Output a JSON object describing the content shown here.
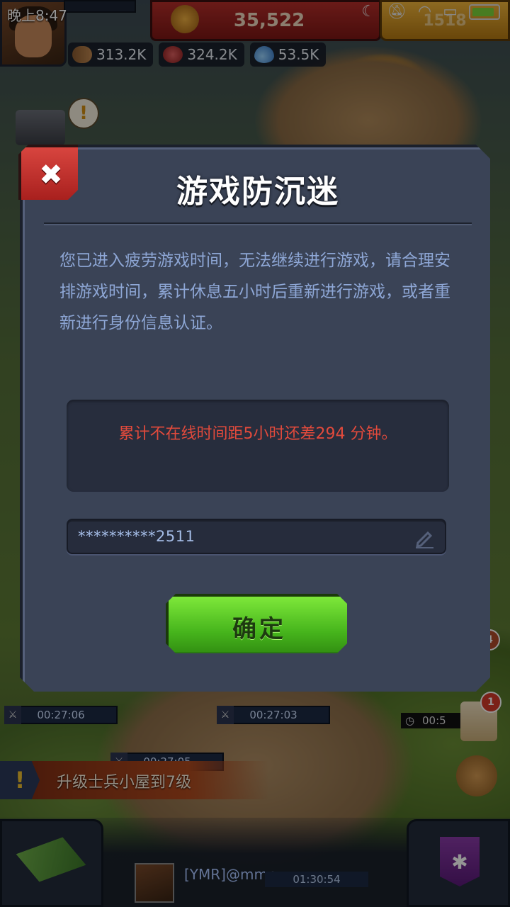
{
  "status_bar": {
    "time": "晚上8:47",
    "icons": [
      "moon-icon",
      "bell-muted-icon",
      "wifi-icon",
      "sim-icon",
      "battery-icon"
    ]
  },
  "hud": {
    "gold": "35,522",
    "gems": "1518",
    "resources": {
      "wood": "313.2K",
      "meat": "324.2K",
      "water": "53.5K"
    }
  },
  "dialog": {
    "title": "游戏防沉迷",
    "message": "您已进入疲劳游戏时间，无法继续进行游戏，请合理安排游戏时间，累计休息五小时后重新进行游戏，或者重新进行身份信息认证。",
    "countdown": "累计不在线时间距5小时还差294 分钟。",
    "id_value": "**********2511",
    "confirm_label": "确定",
    "close_glyph": "✖"
  },
  "timers": {
    "left_1": "00:27:06",
    "left_2": "00:27:03",
    "lower": "00:27:05",
    "right_clock": "00:5",
    "chat": "01:30:54"
  },
  "quest": {
    "label": "升级士兵小屋到7级"
  },
  "chat": {
    "name": "[YMR]@mmp:"
  },
  "badges": {
    "scroll": "1",
    "side": "4"
  },
  "colors": {
    "dialog_bg": "#3a4356",
    "countdown_red": "#e24a3c",
    "message_blue": "#8ea7d6",
    "confirm_green": "#46b41c",
    "close_red": "#c0302c"
  }
}
